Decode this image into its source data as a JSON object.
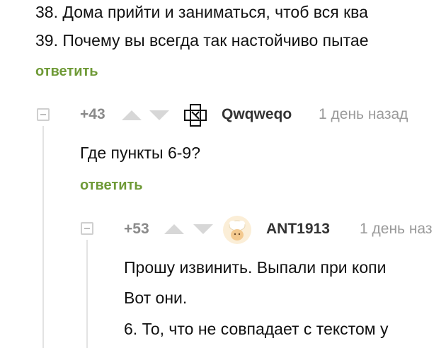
{
  "post": {
    "lines": [
      "38. Дома прийти и заниматься, чтоб вся ква",
      "39. Почему вы всегда так настойчиво пытае"
    ],
    "reply_label": "ответить"
  },
  "comment1": {
    "rating": "+43",
    "author": "Qwqweqo",
    "time": "1 день назад",
    "text": "Где пункты 6-9?",
    "reply_label": "ответить",
    "avatar_icon": "rammstein-logo-icon"
  },
  "comment2": {
    "rating": "+53",
    "author": "ANT1913",
    "time": "1 день наз",
    "lines": [
      "Прошу извинить. Выпали при копи",
      "Вот они.",
      "6. То, что не совпадает с текстом у"
    ],
    "avatar_icon": "chef-avatar-icon"
  },
  "colors": {
    "reply_green": "#6f9a37",
    "muted_gray": "#8a8a8a",
    "vote_arrow": "#d7d7d7"
  }
}
